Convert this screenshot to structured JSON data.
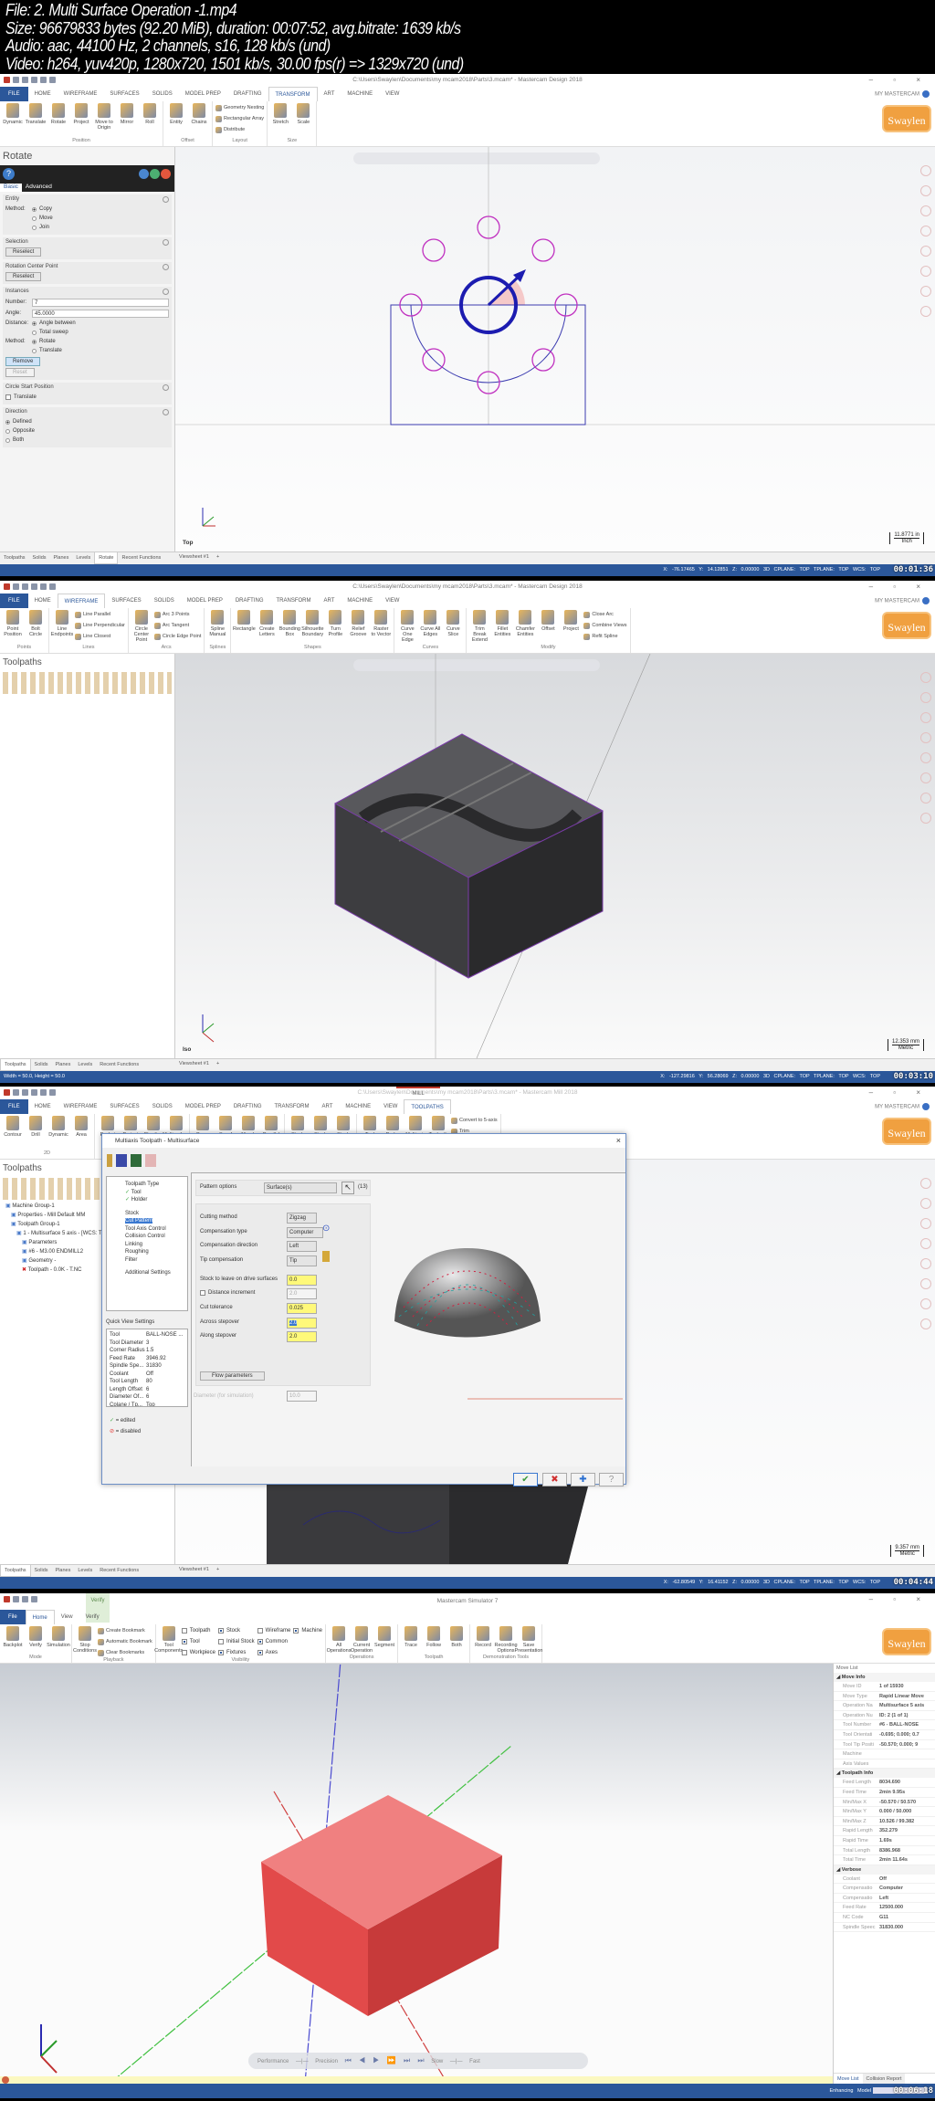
{
  "header": {
    "lines": [
      "File: 2. Multi Surface Operation -1.mp4",
      "Size: 96679833 bytes (92.20 MiB), duration: 00:07:52, avg.bitrate: 1639 kb/s",
      "Audio: aac, 44100 Hz, 2 channels, s16, 128 kb/s (und)",
      "Video: h264, yuv420p, 1280x720, 1501 kb/s, 30.00 fps(r) => 1329x720 (und)"
    ]
  },
  "brand": {
    "logo": "Swaylen",
    "accent": "#2b579a",
    "logo_color": "#f0a040"
  },
  "mastercam_tabs": [
    "FILE",
    "HOME",
    "WIREFRAME",
    "SURFACES",
    "SOLIDS",
    "MODEL PREP",
    "DRAFTING",
    "TRANSFORM",
    "ART",
    "MACHINE",
    "VIEW"
  ],
  "frames": [
    {
      "title": "C:\\Users\\Swaylen\\Documents\\my mcam2018\\Parts\\3.mcam* - Mastercam Design 2018",
      "active_tab": "TRANSFORM",
      "my_mastercam": "MY MASTERCAM",
      "ribbon": [
        {
          "label": "Position",
          "items": [
            "Dynamic",
            "Translate",
            "Rotate",
            "Project",
            "Move to Origin",
            "Mirror",
            "Roll"
          ]
        },
        {
          "label": "Offset",
          "items": [
            "Entity",
            "Chains"
          ]
        },
        {
          "label": "Layout",
          "small": [
            "Geometry Nesting",
            "Rectangular Array",
            "Distribute"
          ]
        },
        {
          "label": "Size",
          "items": [
            "Stretch",
            "Scale"
          ]
        }
      ],
      "panel": {
        "title": "Rotate",
        "tabs": [
          "Basic",
          "Advanced"
        ],
        "entity": {
          "header": "Entity",
          "method_label": "Method:",
          "options": [
            "Copy",
            "Move",
            "Join"
          ],
          "selected": "Copy"
        },
        "selection": {
          "header": "Selection",
          "button": "Reselect"
        },
        "center": {
          "header": "Rotation Center Point",
          "button": "Reselect"
        },
        "instances": {
          "header": "Instances",
          "number_label": "Number:",
          "number": "7",
          "angle_label": "Angle:",
          "angle": "45.0000",
          "distance_label": "Distance:",
          "distance_options": [
            "Angle between",
            "Total sweep"
          ],
          "method_label": "Method:",
          "method_options": [
            "Rotate",
            "Translate"
          ],
          "remove": "Remove",
          "reset": "Reset"
        },
        "circle_start": {
          "header": "Circle Start Position",
          "translate": "Translate",
          "checked": false
        },
        "direction": {
          "header": "Direction",
          "options": [
            "Defined",
            "Opposite",
            "Both"
          ],
          "selected": "Defined"
        }
      },
      "bottom_tabs": [
        "Toolpaths",
        "Solids",
        "Planes",
        "Levels",
        "Rotate",
        "Recent Functions"
      ],
      "bottom_active": "Rotate",
      "viewsheet": "Viewsheet #1",
      "view": "Top",
      "scale": "11.8771 in",
      "units": "Inch",
      "status_left": "",
      "status": "X: -76.17465   Y: 14.12851   Z: 0.00000   3D   CPLANE: TOP   TPLANE: TOP   WCS: TOP",
      "time": "00:01:36"
    },
    {
      "title": "C:\\Users\\Swaylen\\Documents\\my mcam2018\\Parts\\3.mcam* - Mastercam Design 2018",
      "active_tab": "WIREFRAME",
      "my_mastercam": "MY MASTERCAM",
      "ribbon": [
        {
          "label": "Points",
          "items": [
            "Point Position",
            "Bolt Circle"
          ]
        },
        {
          "label": "Lines",
          "items": [
            "Line Endpoints"
          ],
          "small": [
            "Line Parallel",
            "Line Perpendicular",
            "Line Closest"
          ]
        },
        {
          "label": "Arcs",
          "items": [
            "Circle Center Point"
          ],
          "small": [
            "Arc 3 Points",
            "Arc Tangent",
            "Circle Edge Point"
          ]
        },
        {
          "label": "Splines",
          "items": [
            "Spline Manual"
          ]
        },
        {
          "label": "Shapes",
          "items": [
            "Rectangle",
            "Create Letters",
            "Bounding Box",
            "Silhouette Boundary",
            "Turn Profile",
            "Relief Groove",
            "Raster to Vector"
          ]
        },
        {
          "label": "Curves",
          "items": [
            "Curve One Edge",
            "Curve All Edges",
            "Curve Slice"
          ]
        },
        {
          "label": "Modify",
          "items": [
            "Trim Break Extend",
            "Fillet Entities",
            "Chamfer Entities",
            "Offset",
            "Project"
          ],
          "small": [
            "Close Arc",
            "Combine Views",
            "Refit Spline"
          ]
        }
      ],
      "panel_title": "Toolpaths",
      "bottom_tabs": [
        "Toolpaths",
        "Solids",
        "Planes",
        "Levels",
        "Recent Functions"
      ],
      "bottom_active": "Toolpaths",
      "viewsheet": "Viewsheet #1",
      "view": "Iso",
      "scale": "12.353 mm",
      "units": "Metric",
      "status_left": "Width = 50.0, Height = 50.0",
      "status": "X: -127.29816   Y: 56.28069   Z: 0.00000   3D   CPLANE: TOP   TPLANE: TOP   WCS: TOP",
      "time": "00:03:10"
    },
    {
      "title": "C:\\Users\\Swaylen\\Documents\\my mcam2018\\Parts\\3.mcam* - Mastercam Mill 2018",
      "context_tab": "MILL",
      "active_tab": "TOOLPATHS",
      "my_mastercam": "MY MASTERCAM",
      "ribbon": [
        {
          "label": "2D",
          "items": [
            "Contour",
            "Drill",
            "Dynamic",
            "Area"
          ]
        },
        {
          "label": "3D",
          "items": [
            "Pocket",
            "Project",
            "Flowline",
            "Multisurface"
          ]
        },
        {
          "label": "Multiaxis",
          "items": [
            "Curve",
            "Swarf",
            "Morph",
            "Parallel"
          ]
        },
        {
          "label": "Stock",
          "items": [
            "Stock",
            "Stock",
            "Stock"
          ]
        },
        {
          "label": "Utilities",
          "items": [
            "Tool",
            "Probe",
            "Multiaxis",
            "Toolpath Transform"
          ],
          "small": [
            "Convert to 5-axis",
            "Trim",
            "Nesting"
          ]
        }
      ],
      "panel_title": "Toolpaths",
      "tree": [
        "Machine Group-1",
        "Properties - Mill Default MM",
        "Toolpath Group-1",
        "1 - Multisurface 5 axis - [WCS: Top]",
        "Parameters",
        "#6 - M3.00 ENDMILL2",
        "Geometry -",
        "Toolpath - 0.0K - T.NC"
      ],
      "dialog": {
        "title": "Multiaxis Toolpath - Multisurface",
        "pages": [
          "Toolpath Type",
          "Tool",
          "Holder",
          "Stock",
          "Cut Pattern",
          "Tool Axis Control",
          "Collision Control",
          "Linking",
          "Roughing",
          "Filter",
          "Additional Settings"
        ],
        "selected_page": "Cut Pattern",
        "pattern_label": "Pattern options",
        "pattern_value": "Surface(s)",
        "pattern_count": "(13)",
        "fields": [
          {
            "label": "Cutting method",
            "value": "Zigzag",
            "kind": "dropdown"
          },
          {
            "label": "Compensation type",
            "value": "Computer",
            "kind": "dropdown"
          },
          {
            "label": "Compensation direction",
            "value": "Left",
            "kind": "dropdown"
          },
          {
            "label": "Tip compensation",
            "value": "Tip",
            "kind": "dropdown"
          },
          {
            "label": "Stock to leave on drive surfaces",
            "value": "0.0",
            "kind": "input"
          },
          {
            "label": "Distance increment",
            "value": "2.0",
            "kind": "disabled",
            "checked": false
          },
          {
            "label": "Cut tolerance",
            "value": "0.025",
            "kind": "input"
          },
          {
            "label": "Across stepover",
            "value": "2.0",
            "kind": "selected"
          },
          {
            "label": "Along stepover",
            "value": "2.0",
            "kind": "input"
          }
        ],
        "flow_button": "Flow parameters",
        "diameter_label": "Diameter (for simulation)",
        "diameter_value": "10.0",
        "quick_view_label": "Quick View Settings",
        "quick_view": [
          [
            "Tool",
            "BALL-NOSE ..."
          ],
          [
            "Tool Diameter",
            "3"
          ],
          [
            "Corner Radius",
            "1.5"
          ],
          [
            "Feed Rate",
            "3946.92"
          ],
          [
            "Spindle Spe...",
            "31830"
          ],
          [
            "Coolant",
            "Off"
          ],
          [
            "Tool Length",
            "80"
          ],
          [
            "Length Offset",
            "6"
          ],
          [
            "Diameter Of...",
            "6"
          ],
          [
            "Cplane / Tp...",
            "Top"
          ]
        ],
        "legend": [
          "= edited",
          "= disabled"
        ]
      },
      "bottom_tabs": [
        "Toolpaths",
        "Solids",
        "Planes",
        "Levels",
        "Recent Functions"
      ],
      "bottom_active": "Toolpaths",
      "viewsheet": "Viewsheet #1",
      "view": "",
      "scale": "9.357 mm",
      "units": "Metric",
      "status_left": "",
      "status": "X: -62.80549   Y: 16.41152   Z: 0.00000   3D   CPLANE: TOP   TPLANE: TOP   WCS: TOP",
      "time": "00:04:44"
    },
    {
      "title": "Mastercam Simulator 7",
      "context_tab": "Verify",
      "tabs": [
        "File",
        "Home",
        "View",
        "Verify"
      ],
      "active_tab": "Home",
      "ribbon": [
        {
          "label": "Mode",
          "items": [
            "Backplot",
            "Verify",
            "Simulation"
          ]
        },
        {
          "label": "Playback",
          "items": [
            "Stop Conditions"
          ],
          "small": [
            "Create Bookmark",
            "Automatic Bookmark",
            "Clear Bookmarks"
          ]
        },
        {
          "label": "Visibility",
          "items": [
            "Tool Components"
          ],
          "checks": [
            [
              "Toolpath",
              false
            ],
            [
              "Tool",
              true
            ],
            [
              "Workpiece",
              false
            ],
            [
              "Stock",
              true
            ],
            [
              "Initial Stock",
              false
            ],
            [
              "Fixtures",
              true
            ],
            [
              "Wireframe",
              false
            ],
            [
              "Common",
              true
            ],
            [
              "Axes",
              true
            ],
            [
              "Machine",
              true
            ]
          ]
        },
        {
          "label": "Operations",
          "items": [
            "All Operations",
            "Current Operation",
            "Segment"
          ]
        },
        {
          "label": "Toolpath",
          "items": [
            "Trace",
            "Follow",
            "Both"
          ]
        },
        {
          "label": "Demonstration Tools",
          "items": [
            "Record",
            "Recording Options",
            "Save Presentation"
          ]
        }
      ],
      "move_list": {
        "title": "Move List",
        "sections": [
          {
            "name": "Move Info",
            "rows": [
              [
                "Move ID",
                "1 of 15930"
              ],
              [
                "Move Type",
                "Rapid Linear Move"
              ],
              [
                "Operation Na",
                "Multisurface 5 axis"
              ],
              [
                "Operation Nu",
                "ID: 2 (1 of 1)"
              ],
              [
                "Tool Number",
                "#6 - BALL-NOSE"
              ],
              [
                "Tool Orientati",
                "-0.695; 0.000; 0.7"
              ],
              [
                "Tool Tip Positi",
                "-50.570; 0.000; 9"
              ],
              [
                "Machine",
                ""
              ],
              [
                "Axis Values",
                ""
              ]
            ]
          },
          {
            "name": "Toolpath Info",
            "rows": [
              [
                "Feed Length",
                "8034.690"
              ],
              [
                "Feed Time",
                "2min 9.95s"
              ],
              [
                "Min/Max X",
                "-50.570 / 50.570"
              ],
              [
                "Min/Max Y",
                "0.000 / 50.000"
              ],
              [
                "Min/Max Z",
                "10.526 / 99.382"
              ],
              [
                "Rapid Length",
                "352.279"
              ],
              [
                "Rapid Time",
                "1.69s"
              ],
              [
                "Total Length",
                "8386.968"
              ],
              [
                "Total Time",
                "2min 11.64s"
              ]
            ]
          },
          {
            "name": "Verbose",
            "rows": [
              [
                "Coolant",
                "Off"
              ],
              [
                "Compensatio",
                "Computer"
              ],
              [
                "Compensatio",
                "Left"
              ],
              [
                "Feed Rate",
                "12500.000"
              ],
              [
                "NC Code",
                "G11"
              ],
              [
                "Spindle Speec",
                "31830.000"
              ]
            ]
          }
        ],
        "tabs": [
          "Move List",
          "Collision Report"
        ]
      },
      "playback": {
        "performance": "Performance",
        "precision": "Precision",
        "slow": "Slow",
        "fast": "Fast"
      },
      "status_right": "Enhancing Model",
      "time": "00:06:18"
    }
  ]
}
